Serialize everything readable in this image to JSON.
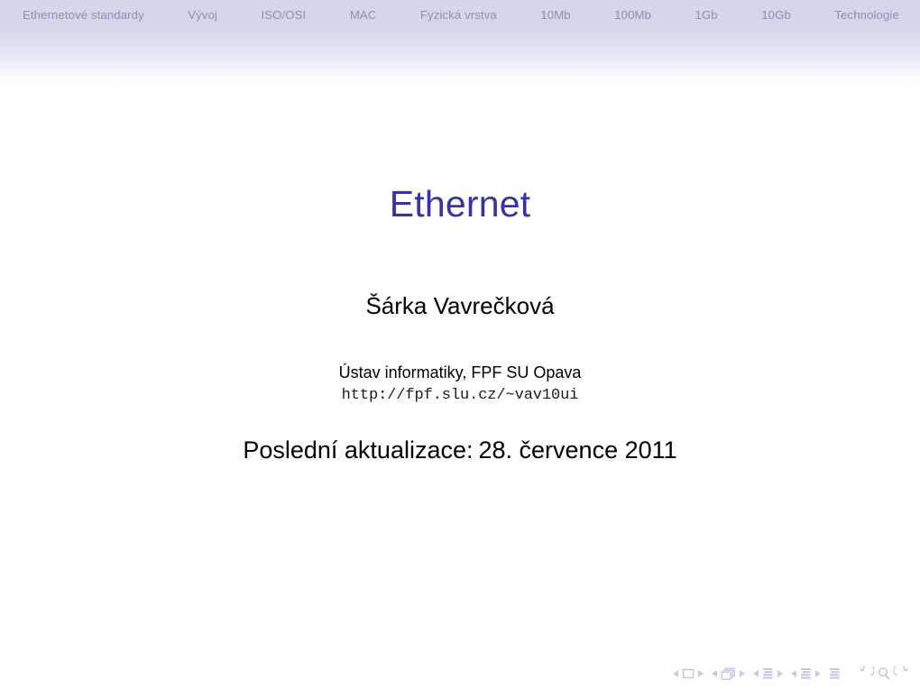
{
  "header": {
    "nav_items": [
      {
        "label": "Ethernetové standardy",
        "name": "nav-ethernetove-standardy"
      },
      {
        "label": "Vývoj",
        "name": "nav-vyvoj"
      },
      {
        "label": "ISO/OSI",
        "name": "nav-iso-osi"
      },
      {
        "label": "MAC",
        "name": "nav-mac"
      },
      {
        "label": "Fyzická vrstva",
        "name": "nav-fyzicka-vrstva"
      },
      {
        "label": "10Mb",
        "name": "nav-10mb"
      },
      {
        "label": "100Mb",
        "name": "nav-100mb"
      },
      {
        "label": "1Gb",
        "name": "nav-1gb"
      },
      {
        "label": "10Gb",
        "name": "nav-10gb"
      },
      {
        "label": "Technologie",
        "name": "nav-technologie"
      }
    ],
    "background_color": "#d4d6e9",
    "text_color": "#8d90b4"
  },
  "titlepage": {
    "title": "Ethernet",
    "title_color": "#3633a8",
    "author": "Šárka Vavrečková",
    "institute": "Ústav informatiky, FPF SU Opava",
    "institute_url": "http://fpf.slu.cz/~vav10ui",
    "date_label": "Poslední aktualizace:",
    "date_value": "28. července 2011"
  },
  "navigation_symbols": {
    "color": "#c3c6e4",
    "groups": [
      {
        "name": "slide-navigation",
        "prev_label": "previous slide",
        "icon": "slide-icon",
        "next_label": "next slide"
      },
      {
        "name": "frame-navigation",
        "prev_label": "previous frame",
        "icon": "frames-icon",
        "next_label": "next frame"
      },
      {
        "name": "subsection-navigation",
        "prev_label": "previous subsection",
        "icon": "subsection-icon",
        "next_label": "next subsection"
      },
      {
        "name": "section-navigation",
        "prev_label": "previous section",
        "icon": "section-icon",
        "next_label": "next section"
      }
    ],
    "document_icon": "document-icon",
    "back_icon": "back-arrow-icon",
    "search_icon": "search-icon",
    "forward_icon": "forward-arrow-icon"
  }
}
